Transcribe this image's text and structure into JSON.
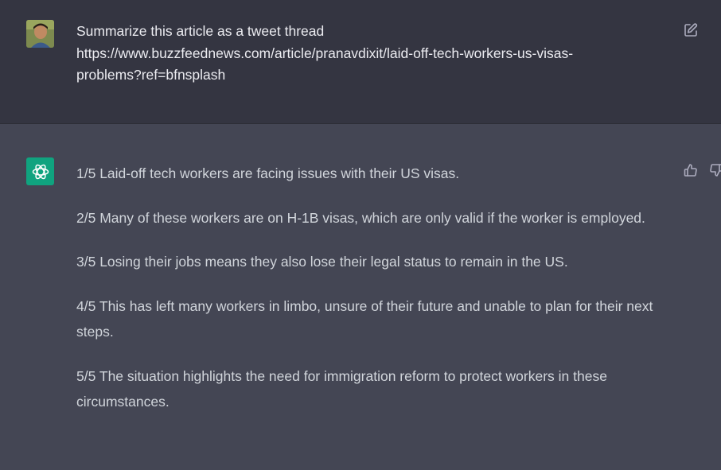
{
  "conversation": {
    "user": {
      "lines": [
        "Summarize this article as a tweet thread",
        "https://www.buzzfeednews.com/article/pranavdixit/laid-off-tech-workers-us-visas-",
        "problems?ref=bfnsplash"
      ],
      "avatar_icon": "user-photo-avatar",
      "edit_icon": "edit-icon"
    },
    "assistant": {
      "avatar_icon": "openai-logo-icon",
      "paragraphs": [
        "1/5 Laid-off tech workers are facing issues with their US visas.",
        "2/5 Many of these workers are on H-1B visas, which are only valid if the worker is employed.",
        "3/5 Losing their jobs means they also lose their legal status to remain in the US.",
        "4/5 This has left many workers in limbo, unsure of their future and unable to plan for their next steps.",
        "5/5 The situation highlights the need for immigration reform to protect workers in these circumstances."
      ],
      "feedback_icons": [
        "thumbs-up-icon",
        "thumbs-down-icon"
      ]
    }
  },
  "colors": {
    "user_bg": "#343541",
    "assistant_bg": "#444654",
    "accent": "#10a37f",
    "text": "#d1d5db"
  }
}
